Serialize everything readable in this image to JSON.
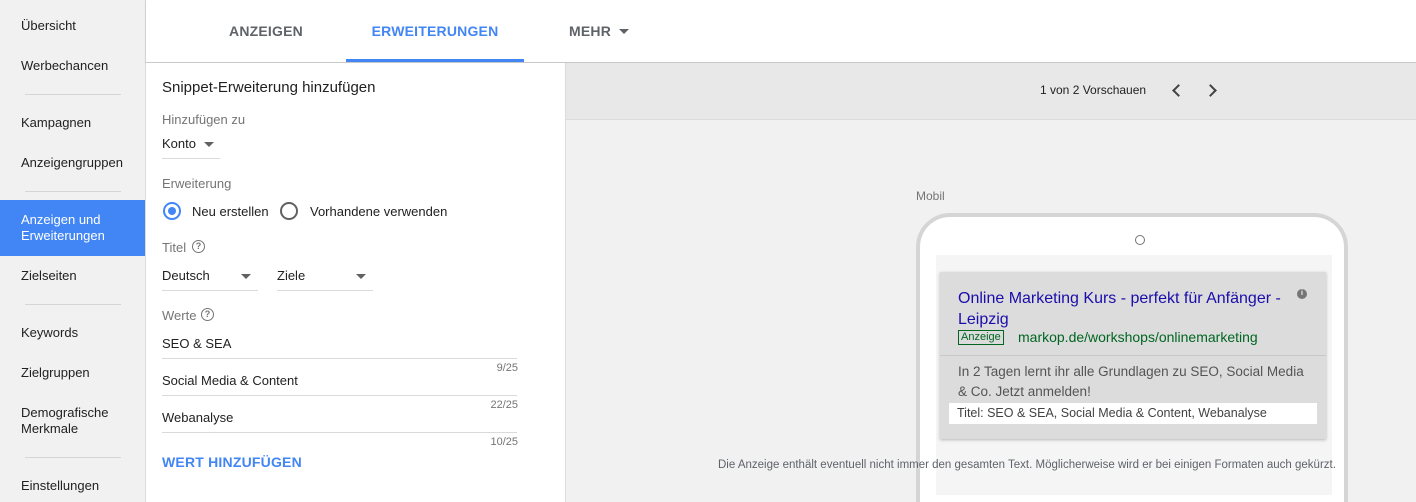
{
  "sidebar": {
    "items": [
      {
        "label": "Übersicht"
      },
      {
        "label": "Werbechancen"
      },
      {
        "label": "Kampagnen"
      },
      {
        "label": "Anzeigengruppen"
      },
      {
        "label": "Anzeigen und Erweiterungen",
        "line1": "Anzeigen und",
        "line2": "Erweiterungen",
        "active": true
      },
      {
        "label": "Zielseiten"
      },
      {
        "label": "Keywords"
      },
      {
        "label": "Zielgruppen"
      },
      {
        "label": "Demografische Merkmale",
        "line1": "Demografische",
        "line2": "Merkmale"
      },
      {
        "label": "Einstellungen"
      }
    ]
  },
  "tabs": {
    "ads": "ANZEIGEN",
    "extensions": "ERWEITERUNGEN",
    "more": "MEHR",
    "active": "extensions"
  },
  "form": {
    "title": "Snippet-Erweiterung hinzufügen",
    "add_to_label": "Hinzufügen zu",
    "add_to_value": "Konto",
    "extension_label": "Erweiterung",
    "radio_new": "Neu erstellen",
    "radio_existing": "Vorhandene verwenden",
    "radio_selected": "new",
    "title_label": "Titel",
    "language_value": "Deutsch",
    "header_value": "Ziele",
    "values_label": "Werte",
    "values": [
      {
        "text": "SEO & SEA",
        "counter": "9/25"
      },
      {
        "text": "Social Media & Content",
        "counter": "22/25"
      },
      {
        "text": "Webanalyse",
        "counter": "10/25"
      }
    ],
    "add_value_button": "WERT HINZUFÜGEN"
  },
  "preview": {
    "pager_text": "1 von 2 Vorschauen",
    "device_label": "Mobil",
    "ad": {
      "title_line1": "Online Marketing Kurs - perfekt für Anfänger -",
      "title_line2": "Leipzig",
      "badge": "Anzeige",
      "url": "markop.de/workshops/onlinemarketing",
      "description_line1": "In 2 Tagen lernt ihr alle Grundlagen zu SEO, Social Media",
      "description_line2": "& Co. Jetzt anmelden!",
      "snippet": "Titel: SEO & SEA, Social Media & Content, Webanalyse"
    },
    "disclaimer": "Die Anzeige enthält eventuell nicht immer den gesamten Text. Möglicherweise wird er bei einigen Formaten auch gekürzt."
  },
  "colors": {
    "accent": "#4285f4",
    "ad_title": "#1a0dab",
    "ad_url": "#006621"
  }
}
